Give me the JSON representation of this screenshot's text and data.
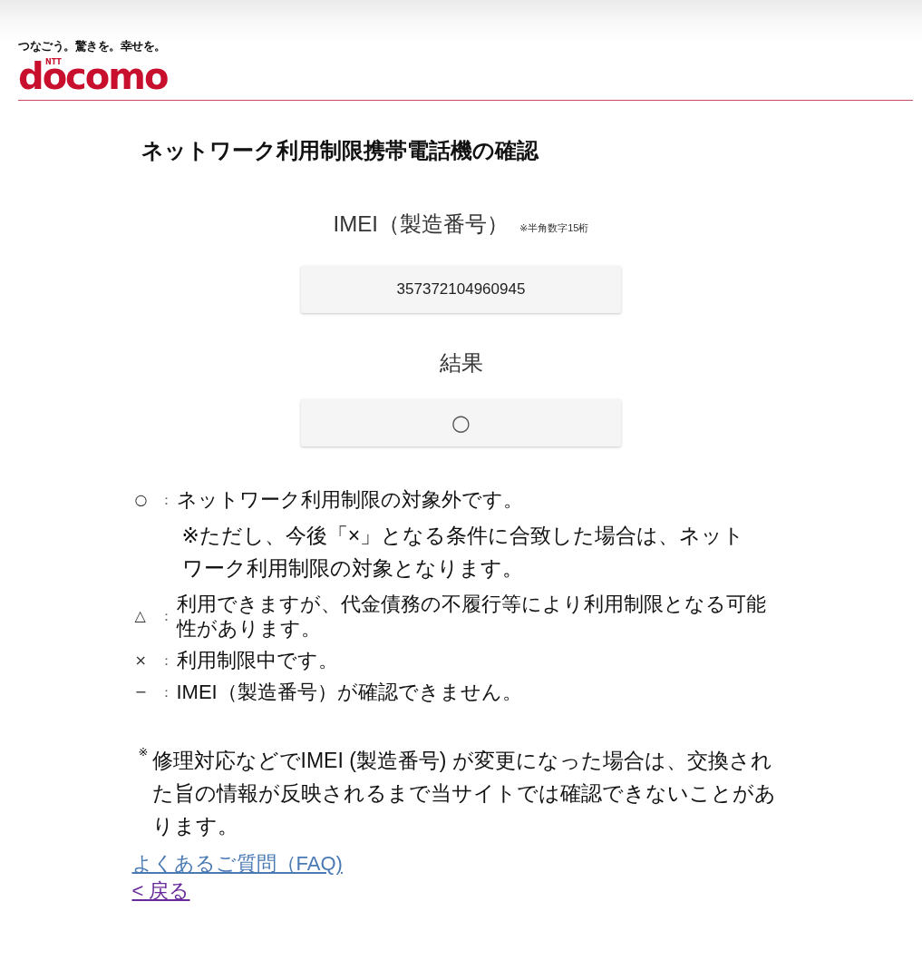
{
  "header": {
    "tagline": "つなごう。驚きを。幸せを。",
    "logo_small": "NTT",
    "logo": "docomo"
  },
  "title": "ネットワーク利用制限携帯電話機の確認",
  "imei": {
    "label": "IMEI（製造番号）",
    "hint": "※半角数字15桁",
    "value": "357372104960945"
  },
  "result": {
    "label": "結果",
    "value": "○"
  },
  "legend": [
    {
      "symbol": "○",
      "separator": "：",
      "text": "ネットワーク利用制限の対象外です。",
      "note": "※ただし、今後「×」となる条件に合致した場合は、ネットワーク利用制限の対象となります。"
    },
    {
      "symbol": "△",
      "separator": "：",
      "text": "利用できますが、代金債務の不履行等により利用制限となる可能性があります。"
    },
    {
      "symbol": "×",
      "separator": "：",
      "text": "利用制限中です。"
    },
    {
      "symbol": "−",
      "separator": "：",
      "text": "IMEI（製造番号）が確認できません。"
    }
  ],
  "footnote": "$^{※}$修理対応などでIMEI (製造番号) が変更になった場合は、交換された旨の情報が反映されるまで当サイトでは確認できないことがあります。",
  "links": [
    {
      "label": "よくあるご質問（FAQ)",
      "visited": false
    },
    {
      "label": "< 戻る",
      "visited": true
    }
  ]
}
